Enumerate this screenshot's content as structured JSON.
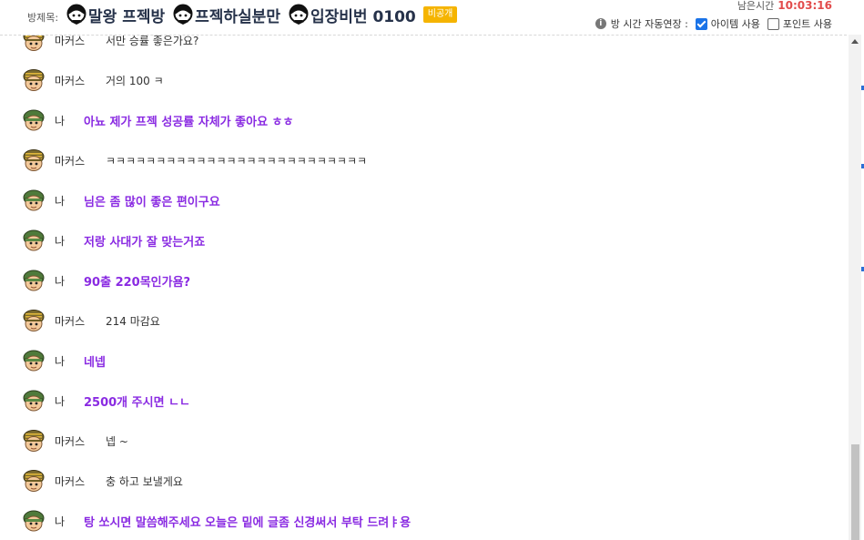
{
  "header": {
    "title_label": "방제목:",
    "title_parts": [
      "말왕 프젝방",
      "프젝하실분만",
      "입장비번 0100"
    ],
    "private_badge": "비공개",
    "remaining_label": "남은시간",
    "remaining_time": "10:03:16",
    "auto_extend_label": "방 시간 자동연장 :",
    "item_use_label": "아이템 사용",
    "item_use_checked": true,
    "point_use_label": "포인트 사용",
    "point_use_checked": false
  },
  "colors": {
    "my_message": "#8a2be2",
    "time_red": "#e24c4c",
    "badge": "#f5b400",
    "checkbox": "#1a73e8"
  },
  "messages": [
    {
      "sender": "마커스",
      "me": false,
      "text": "서만 승률 좋은가요?"
    },
    {
      "sender": "마커스",
      "me": false,
      "text": "거의 100 ㅋ"
    },
    {
      "sender": "나",
      "me": true,
      "text": "아뇨 제가 프젝 성공률 자체가 좋아요 ㅎㅎ"
    },
    {
      "sender": "마커스",
      "me": false,
      "text": "ㅋㅋㅋㅋㅋㅋㅋㅋㅋㅋㅋㅋㅋㅋㅋㅋㅋㅋㅋㅋㅋㅋㅋㅋㅋㅋ"
    },
    {
      "sender": "나",
      "me": true,
      "text": "님은 좀 많이 좋은 편이구요"
    },
    {
      "sender": "나",
      "me": true,
      "text": "저랑 사대가 잘 맞는거죠"
    },
    {
      "sender": "나",
      "me": true,
      "text": "90출 220목인가욤?"
    },
    {
      "sender": "마커스",
      "me": false,
      "text": "214 마감요"
    },
    {
      "sender": "나",
      "me": true,
      "text": "네넵"
    },
    {
      "sender": "나",
      "me": true,
      "text": "2500개 주시면 ㄴㄴ"
    },
    {
      "sender": "마커스",
      "me": false,
      "text": "넵 ~"
    },
    {
      "sender": "마커스",
      "me": false,
      "text": "충 하고 보낼게요"
    },
    {
      "sender": "나",
      "me": true,
      "text": "탕 쏘시면 말씀해주세요 오늘은 밑에 글좀 신경써서 부탁 드려ㅑ용"
    }
  ]
}
